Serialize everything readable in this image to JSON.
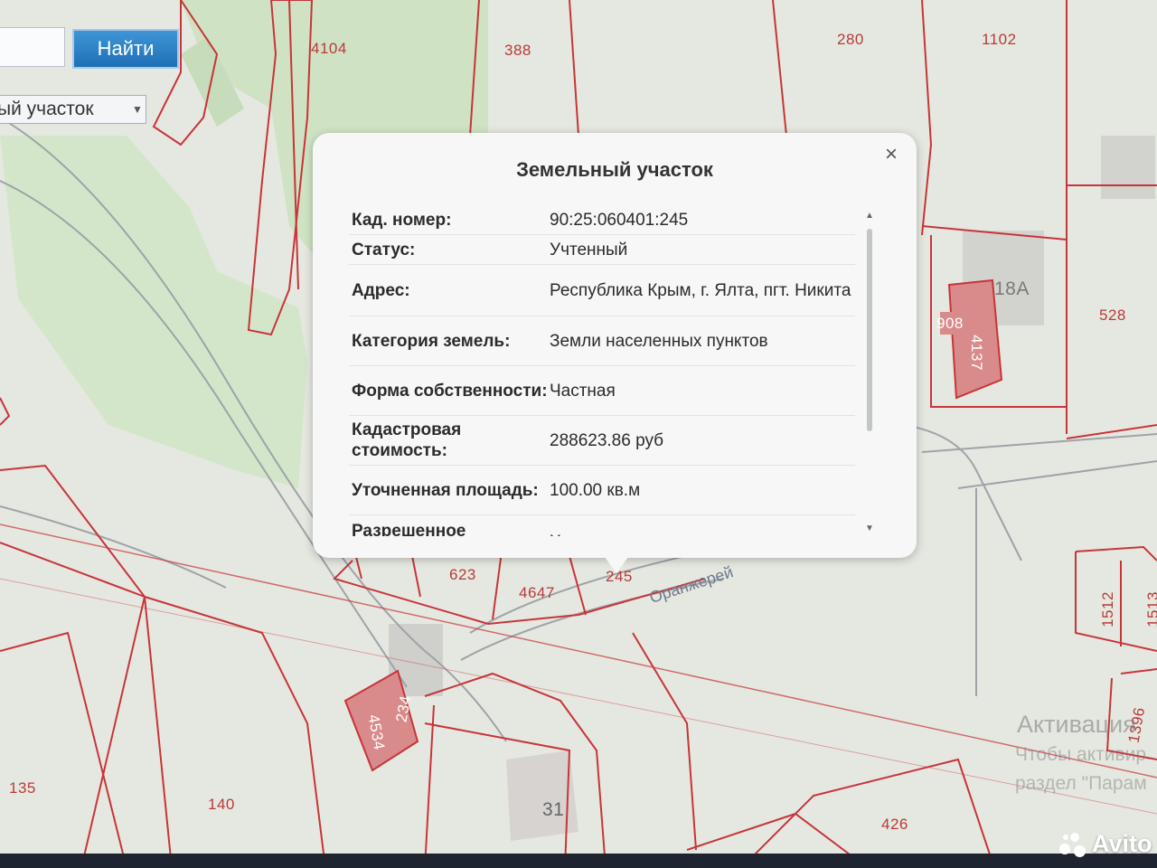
{
  "search": {
    "button_label": "Найти",
    "input_value": ""
  },
  "layer_select": {
    "selected": "ый участок"
  },
  "map": {
    "plot_numbers": [
      "4104",
      "388",
      "280",
      "1102",
      "18А",
      "908",
      "4137",
      "528",
      "623",
      "4647",
      "245",
      "1512",
      "1513",
      "234",
      "4534",
      "1396",
      "135",
      "140",
      "31",
      "426"
    ],
    "street_label": "Оранжерей"
  },
  "popup": {
    "title": "Земельный участок",
    "close_label": "×",
    "rows": [
      {
        "label": "Кад. номер:",
        "value": "90:25:060401:245"
      },
      {
        "label": "Статус:",
        "value": "Учтенный"
      },
      {
        "label": "Адрес:",
        "value": "Республика Крым, г. Ялта, пгт. Никита"
      },
      {
        "label": "Категория земель:",
        "value": "Земли населенных пунктов"
      },
      {
        "label": "Форма собственности:",
        "value": "Частная"
      },
      {
        "label": "Кадастровая стоимость:",
        "value": "288623.86 руб"
      },
      {
        "label": "Уточненная площадь:",
        "value": "100.00 кв.м"
      },
      {
        "label": "Разрешенное",
        "value": "Хранение автотранспорта"
      }
    ]
  },
  "watermark": {
    "line1": "Активация",
    "line2": "Чтобы активир",
    "line3": "раздел \"Парам"
  },
  "avito_logo": "Avito",
  "colors": {
    "plot_border": "#c8343a",
    "building_fill": "#d98a8a",
    "map_green": "#c8e0bd",
    "button_blue": "#2a80c4"
  }
}
